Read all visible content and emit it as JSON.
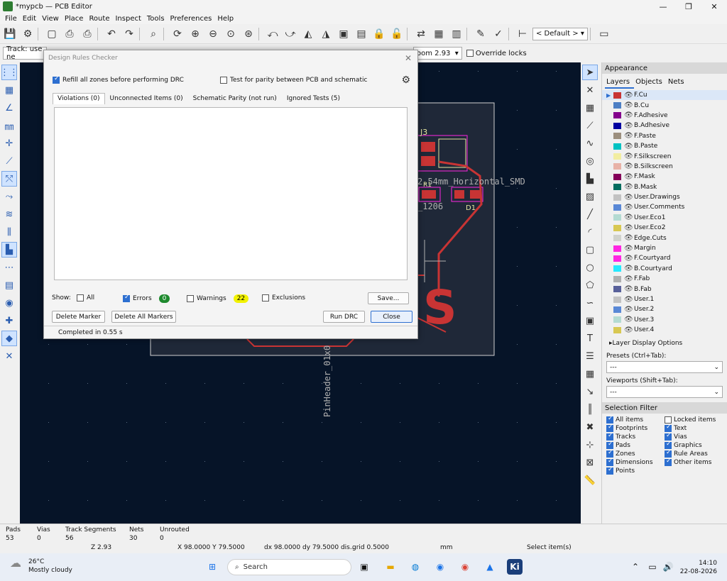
{
  "window": {
    "title": "*mypcb — PCB Editor",
    "minimize": "—",
    "maximize": "❐",
    "close": "✕"
  },
  "menu": [
    "File",
    "Edit",
    "View",
    "Place",
    "Route",
    "Inspect",
    "Tools",
    "Preferences",
    "Help"
  ],
  "toolbar": {
    "preset_select": "< Default >"
  },
  "toolbar2": {
    "track_label": "Track: use ne",
    "zoom_label": "oom 2.93",
    "override_locks_label": "Override locks"
  },
  "canvas": {
    "ref_j3": "J3",
    "ref_r1": "R1",
    "ref_d1": "D1",
    "footprint_text": "2.54mm_Horizontal_SMD",
    "size_text": "_1206",
    "pinheader_text": "PinHeader_01x0",
    "big_letter": "S",
    "colors": {
      "background": "#061428",
      "fcu": "#c83434",
      "silkscreen": "#e6e6a0",
      "courtyard": "#ff26e2",
      "edge": "#d0d0d0"
    }
  },
  "right_panel": {
    "appearance_header": "Appearance",
    "tabs": [
      "Layers",
      "Objects",
      "Nets"
    ],
    "layers": [
      {
        "name": "F.Cu",
        "color": "#c83434"
      },
      {
        "name": "B.Cu",
        "color": "#4d7fc4"
      },
      {
        "name": "F.Adhesive",
        "color": "#84008c"
      },
      {
        "name": "B.Adhesive",
        "color": "#0000a0"
      },
      {
        "name": "F.Paste",
        "color": "#9c8f7e"
      },
      {
        "name": "B.Paste",
        "color": "#00c2c2"
      },
      {
        "name": "F.Silkscreen",
        "color": "#f2eda1"
      },
      {
        "name": "B.Silkscreen",
        "color": "#e8b2a7"
      },
      {
        "name": "F.Mask",
        "color": "#84005a"
      },
      {
        "name": "B.Mask",
        "color": "#026c5e"
      },
      {
        "name": "User.Drawings",
        "color": "#c2c2c2"
      },
      {
        "name": "User.Comments",
        "color": "#5988d6"
      },
      {
        "name": "User.Eco1",
        "color": "#b4dbd2"
      },
      {
        "name": "User.Eco2",
        "color": "#d8c852"
      },
      {
        "name": "Edge.Cuts",
        "color": "#d0d2cd"
      },
      {
        "name": "Margin",
        "color": "#ff26e2"
      },
      {
        "name": "F.Courtyard",
        "color": "#ff26e2"
      },
      {
        "name": "B.Courtyard",
        "color": "#26e9ff"
      },
      {
        "name": "F.Fab",
        "color": "#afafaf"
      },
      {
        "name": "B.Fab",
        "color": "#58609a"
      },
      {
        "name": "User.1",
        "color": "#c2c2c2"
      },
      {
        "name": "User.2",
        "color": "#5988d6"
      },
      {
        "name": "User.3",
        "color": "#b4dbd2"
      },
      {
        "name": "User.4",
        "color": "#d8c852"
      }
    ],
    "layer_display_options": "Layer Display Options",
    "presets_label": "Presets (Ctrl+Tab):",
    "presets_value": "---",
    "viewports_label": "Viewports (Shift+Tab):",
    "viewports_value": "---",
    "selection_filter_header": "Selection Filter",
    "selection_filter": [
      {
        "label": "All items",
        "checked": true
      },
      {
        "label": "Locked items",
        "checked": false
      },
      {
        "label": "Footprints",
        "checked": true
      },
      {
        "label": "Text",
        "checked": true
      },
      {
        "label": "Tracks",
        "checked": true
      },
      {
        "label": "Vias",
        "checked": true
      },
      {
        "label": "Pads",
        "checked": true
      },
      {
        "label": "Graphics",
        "checked": true
      },
      {
        "label": "Zones",
        "checked": true
      },
      {
        "label": "Rule Areas",
        "checked": true
      },
      {
        "label": "Dimensions",
        "checked": true
      },
      {
        "label": "Other items",
        "checked": true
      },
      {
        "label": "Points",
        "checked": true
      }
    ]
  },
  "dialog": {
    "title": "Design Rules Checker",
    "close": "✕",
    "refill_label": "Refill all zones before performing DRC",
    "parity_label": "Test for parity between PCB and schematic",
    "tabs": [
      "Violations (0)",
      "Unconnected Items (0)",
      "Schematic Parity (not run)",
      "Ignored Tests (5)"
    ],
    "show_label": "Show:",
    "all_label": "All",
    "errors_label": "Errors",
    "errors_count": "0",
    "warnings_label": "Warnings",
    "warnings_count": "22",
    "exclusions_label": "Exclusions",
    "save_button": "Save...",
    "delete_marker": "Delete Marker",
    "delete_all_markers": "Delete All Markers",
    "run_drc": "Run DRC",
    "close_button": "Close",
    "status": "Completed in 0.55 s"
  },
  "status": {
    "pads_label": "Pads",
    "pads_value": "53",
    "vias_label": "Vias",
    "vias_value": "0",
    "tracks_label": "Track Segments",
    "tracks_value": "56",
    "nets_label": "Nets",
    "nets_value": "30",
    "unrouted_label": "Unrouted",
    "unrouted_value": "0",
    "zoom": "Z 2.93",
    "xy": "X 98.0000  Y 79.5000",
    "dxdy": "dx 98.0000  dy 79.5000  dis...",
    "grid": "grid 0.5000",
    "units": "mm",
    "message": "Select item(s)"
  },
  "taskbar": {
    "temp": "26°C",
    "weather": "Mostly cloudy",
    "search": "Search",
    "time": "14:10",
    "date": "22-08-2026"
  }
}
